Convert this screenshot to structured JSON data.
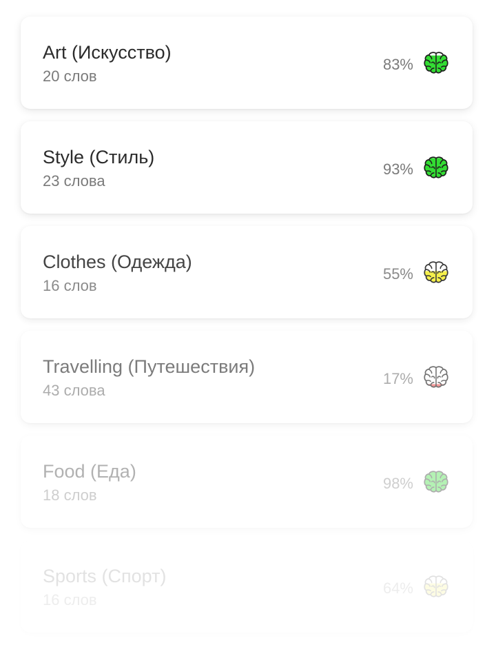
{
  "categories": [
    {
      "title": "Art (Искусство)",
      "count": "20 слов",
      "percent": "83%",
      "progress": 0.83,
      "color": "#33dd33",
      "icon": "brain-icon"
    },
    {
      "title": "Style (Стиль)",
      "count": "23 слова",
      "percent": "93%",
      "progress": 0.93,
      "color": "#33dd33",
      "icon": "brain-icon"
    },
    {
      "title": "Clothes (Одежда)",
      "count": "16 слов",
      "percent": "55%",
      "progress": 0.55,
      "color": "#f4ee33",
      "icon": "brain-icon"
    },
    {
      "title": "Travelling (Путешествия)",
      "count": "43 слова",
      "percent": "17%",
      "progress": 0.17,
      "color": "#ee5b5b",
      "icon": "brain-icon"
    },
    {
      "title": "Food (Еда)",
      "count": "18 слов",
      "percent": "98%",
      "progress": 0.98,
      "color": "#33dd33",
      "icon": "brain-icon"
    },
    {
      "title": "Sports (Спорт)",
      "count": "16 слов",
      "percent": "64%",
      "progress": 0.64,
      "color": "#f4ee33",
      "icon": "brain-icon"
    }
  ]
}
